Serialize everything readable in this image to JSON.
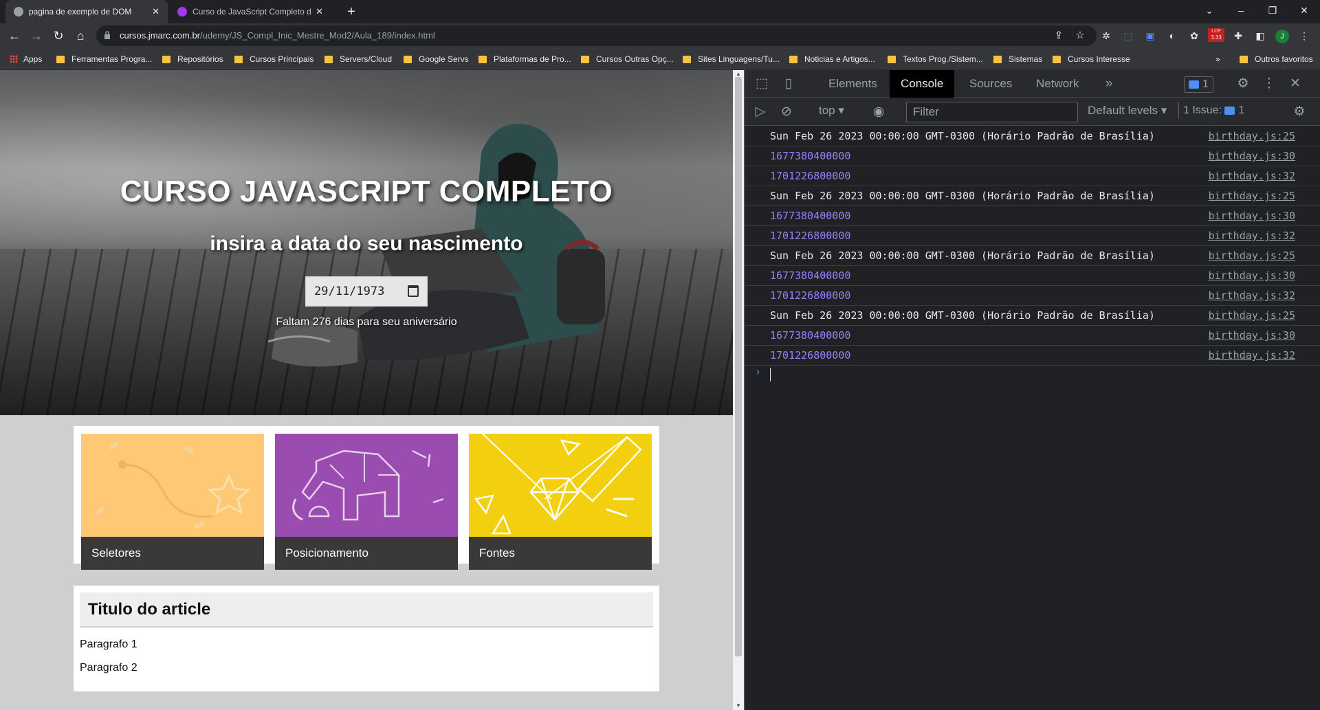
{
  "browser": {
    "tabs": [
      {
        "title": "pagina de exemplo de DOM",
        "close": "✕"
      },
      {
        "title": "Curso de JavaScript Completo do",
        "close": "✕"
      }
    ],
    "new_tab": "+",
    "url_host": "cursos.jmarc.com.br",
    "url_path": "/udemy/JS_Compl_Inic_Mestre_Mod2/Aula_189/index.html",
    "extension_badge": "3.33",
    "profile_initial": "J"
  },
  "bookmarks": {
    "apps": "Apps",
    "items": [
      "Ferramentas Progra...",
      "Repositórios",
      "Cursos Principais",
      "Servers/Cloud",
      "Google Servs",
      "Plataformas de Pro...",
      "Cursos Outras Opç...",
      "Sites Linguagens/Tu...",
      "Noticias e Artigos...",
      "Textos Prog./Sistem...",
      "Sistemas",
      "Cursos Interesse"
    ],
    "more": "»",
    "other": "Outros favoritos"
  },
  "page": {
    "title": "CURSO JAVASCRIPT COMPLETO",
    "subtitle": "insira a data do seu nascimento",
    "date_value": "29/11/1973",
    "message": "Faltam 276 dias para seu aniversário",
    "cards": [
      {
        "label": "Seletores",
        "color": "#ffc875"
      },
      {
        "label": "Posicionamento",
        "color": "#9b4cb1"
      },
      {
        "label": "Fontes",
        "color": "#f2cf0f"
      }
    ],
    "article": {
      "title": "Titulo do article",
      "paragraphs": [
        "Paragrafo 1",
        "Paragrafo 2"
      ]
    }
  },
  "devtools": {
    "tabs": [
      "Elements",
      "Console",
      "Sources",
      "Network"
    ],
    "more_tabs": "»",
    "messages_badge": "1",
    "context": "top",
    "filter_placeholder": "Filter",
    "levels": "Default levels",
    "issues": "1 Issue:",
    "issues_count": "1",
    "console_rows": [
      {
        "text": "Sun Feb 26 2023 00:00:00 GMT-0300 (Horário Padrão de Brasília)",
        "kind": "text",
        "source": "birthday.js:25"
      },
      {
        "text": "1677380400000",
        "kind": "num",
        "source": "birthday.js:30"
      },
      {
        "text": "1701226800000",
        "kind": "num",
        "source": "birthday.js:32"
      },
      {
        "text": "Sun Feb 26 2023 00:00:00 GMT-0300 (Horário Padrão de Brasília)",
        "kind": "text",
        "source": "birthday.js:25"
      },
      {
        "text": "1677380400000",
        "kind": "num",
        "source": "birthday.js:30"
      },
      {
        "text": "1701226800000",
        "kind": "num",
        "source": "birthday.js:32"
      },
      {
        "text": "Sun Feb 26 2023 00:00:00 GMT-0300 (Horário Padrão de Brasília)",
        "kind": "text",
        "source": "birthday.js:25"
      },
      {
        "text": "1677380400000",
        "kind": "num",
        "source": "birthday.js:30"
      },
      {
        "text": "1701226800000",
        "kind": "num",
        "source": "birthday.js:32"
      },
      {
        "text": "Sun Feb 26 2023 00:00:00 GMT-0300 (Horário Padrão de Brasília)",
        "kind": "text",
        "source": "birthday.js:25"
      },
      {
        "text": "1677380400000",
        "kind": "num",
        "source": "birthday.js:30"
      },
      {
        "text": "1701226800000",
        "kind": "num",
        "source": "birthday.js:32"
      }
    ],
    "prompt": "›"
  }
}
